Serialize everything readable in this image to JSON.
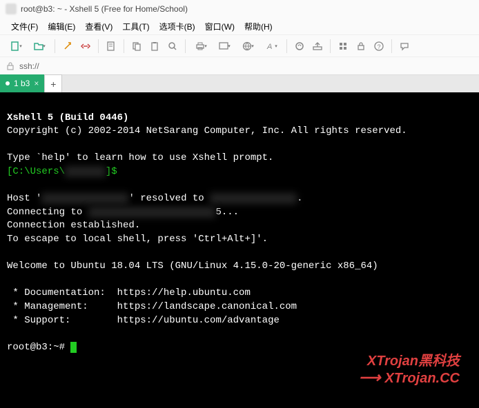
{
  "window": {
    "title": "root@b3: ~ - Xshell 5 (Free for Home/School)"
  },
  "menu": {
    "file": "文件(F)",
    "edit": "编辑(E)",
    "view": "查看(V)",
    "tools": "工具(T)",
    "tabs": "选项卡(B)",
    "window": "窗口(W)",
    "help": "帮助(H)"
  },
  "toolbar": {
    "icons": {
      "newdoc": "new-doc",
      "newfolder": "new-folder",
      "wand": "wand",
      "disconnect": "disconnect",
      "props": "properties",
      "copy1": "copy",
      "copy2": "copy-stack",
      "search": "search",
      "print": "print",
      "screen": "screen",
      "globe": "globe",
      "font": "font",
      "refresh": "refresh",
      "keypad": "keypad",
      "lock": "lock",
      "question": "question",
      "bubble": "bubble"
    }
  },
  "address": {
    "scheme": "ssh://",
    "value": ""
  },
  "tab": {
    "label": "1 b3",
    "new": "+"
  },
  "term": {
    "l1": "Xshell 5 (Build 0446)",
    "l2": "Copyright (c) 2002-2014 NetSarang Computer, Inc. All rights reserved.",
    "l3": "Type `help' to learn how to use Xshell prompt.",
    "prompt_open": "[C:\\Users\\",
    "prompt_hidden": "xxxxxxx",
    "prompt_close": "]$",
    "host_a": "Host '",
    "host_hidden1": "xxxxxxxxxxxxxxx",
    "host_b": "' resolved to ",
    "host_hidden2": "xxxxxxxxxxxxxxx",
    "host_c": ".",
    "conn_a": "Connecting to ",
    "conn_hidden": "xxxxxxxxxxxxxxxxxxxxxx",
    "conn_b": "5...",
    "l_est": "Connection established.",
    "l_esc": "To escape to local shell, press 'Ctrl+Alt+]'.",
    "welcome": "Welcome to Ubuntu 18.04 LTS (GNU/Linux 4.15.0-20-generic x86_64)",
    "doc": " * Documentation:  https://help.ubuntu.com",
    "mgmt": " * Management:     https://landscape.canonical.com",
    "sup": " * Support:        https://ubuntu.com/advantage",
    "shell": "root@b3:~# "
  },
  "watermark": {
    "line1": "XTrojan黑科技",
    "line2": "XTrojan.CC",
    "arrow": "⟶"
  }
}
